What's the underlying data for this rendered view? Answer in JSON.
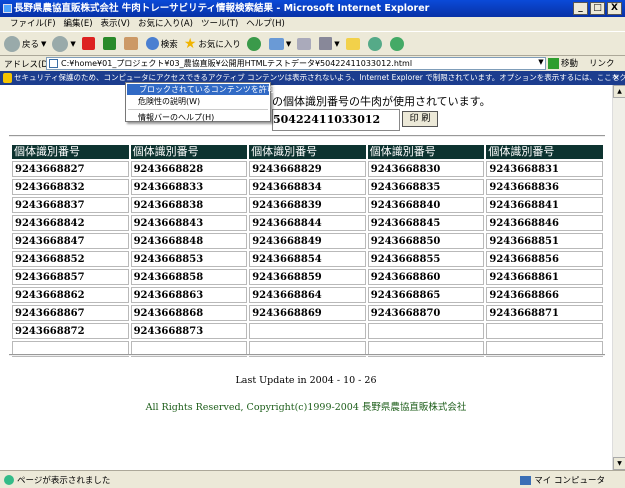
{
  "window": {
    "title": "長野県農協直販株式会社 牛肉トレーサビリティ情報検索結果 - Microsoft Internet Explorer",
    "min": "_",
    "max": "□",
    "close": "X"
  },
  "menu": [
    "ファイル(F)",
    "編集(E)",
    "表示(V)",
    "お気に入り(A)",
    "ツール(T)",
    "ヘルプ(H)"
  ],
  "toolbar": {
    "back": "戻る",
    "search": "検索",
    "favorites": "お気に入り"
  },
  "address": {
    "label": "アドレス(D)",
    "value": "C:¥home¥01_プロジェクト¥03_農協直販¥公開用HTMLテストデータ¥50422411033012.html",
    "go": "移動",
    "links": "リンク"
  },
  "infobar": {
    "text": "セキュリティ保護のため、コンピュータにアクセスできるアクティブ コンテンツは表示されないよう、Internet Explorer で制限されています。オプションを表示するには、ここをクリックしてください...",
    "close": "×"
  },
  "context_menu": [
    "ブロックされているコンテンツを許可(A)...",
    "危険性の説明(W)",
    "情報バーのヘルプ(H)"
  ],
  "page": {
    "usage_text": "の個体識別番号の牛肉が使用されています。",
    "id_value": "50422411033012",
    "print_label": "印 刷",
    "column_header": "個体識別番号",
    "rows": [
      [
        "9243668827",
        "9243668828",
        "9243668829",
        "9243668830",
        "9243668831"
      ],
      [
        "9243668832",
        "9243668833",
        "9243668834",
        "9243668835",
        "9243668836"
      ],
      [
        "9243668837",
        "9243668838",
        "9243668839",
        "9243668840",
        "9243668841"
      ],
      [
        "9243668842",
        "9243668843",
        "9243668844",
        "9243668845",
        "9243668846"
      ],
      [
        "9243668847",
        "9243668848",
        "9243668849",
        "9243668850",
        "9243668851"
      ],
      [
        "9243668852",
        "9243668853",
        "9243668854",
        "9243668855",
        "9243668856"
      ],
      [
        "9243668857",
        "9243668858",
        "9243668859",
        "9243668860",
        "9243668861"
      ],
      [
        "9243668862",
        "9243668863",
        "9243668864",
        "9243668865",
        "9243668866"
      ],
      [
        "9243668867",
        "9243668868",
        "9243668869",
        "9243668870",
        "9243668871"
      ],
      [
        "9243668872",
        "9243668873",
        "",
        "",
        ""
      ],
      [
        "",
        "",
        "",
        "",
        ""
      ]
    ],
    "last_update": "Last Update in 2004 - 10 - 26",
    "copyright": "All Rights Reserved, Copyright(c)1999-2004 長野県農協直販株式会社"
  },
  "status": {
    "text": "ページが表示されました",
    "zone": "マイ コンピュータ"
  }
}
